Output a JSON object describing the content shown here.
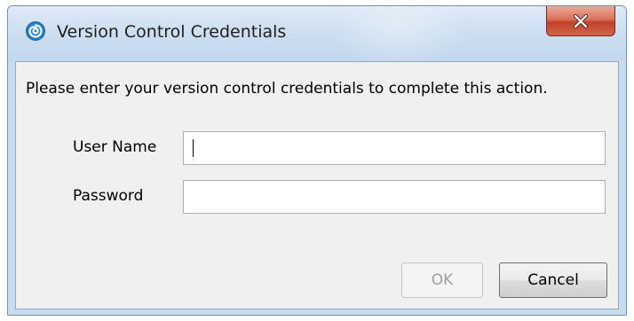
{
  "window": {
    "title": "Version Control Credentials",
    "icon": "spiral-app-icon",
    "close_icon": "close-x-icon"
  },
  "dialog": {
    "message": "Please enter your version control credentials to complete this action.",
    "username_label": "User Name",
    "username_value": "",
    "password_label": "Password",
    "password_value": "",
    "ok_label": "OK",
    "ok_enabled": false,
    "cancel_label": "Cancel"
  },
  "colors": {
    "titlebar": "#c9dcef",
    "close_button": "#c2412a",
    "client_background": "#f0f0f0",
    "disabled_text": "#a0a0a0"
  }
}
